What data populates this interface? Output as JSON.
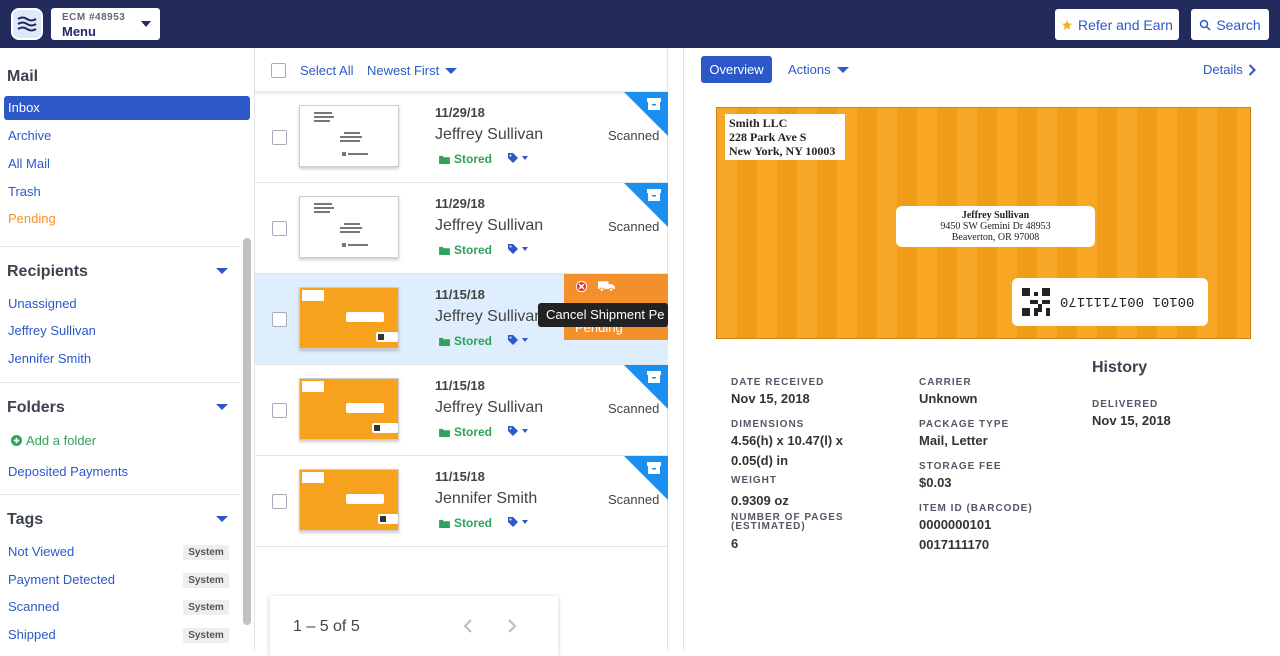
{
  "header": {
    "menu_small": "ECM #48953",
    "menu_big": "Menu",
    "refer_label": "Refer and Earn",
    "search_label": "Search"
  },
  "sidebar": {
    "mail_title": "Mail",
    "mail_items": [
      {
        "label": "Inbox"
      },
      {
        "label": "Archive"
      },
      {
        "label": "All Mail"
      },
      {
        "label": "Trash"
      },
      {
        "label": "Pending"
      }
    ],
    "recipients_title": "Recipients",
    "recipients": [
      {
        "label": "Unassigned"
      },
      {
        "label": "Jeffrey Sullivan"
      },
      {
        "label": "Jennifer Smith"
      }
    ],
    "folders_title": "Folders",
    "add_folder": "Add a folder",
    "folders": [
      {
        "label": "Deposited Payments"
      }
    ],
    "tags_title": "Tags",
    "tags": [
      {
        "label": "Not Viewed",
        "badge": "System"
      },
      {
        "label": "Payment Detected",
        "badge": "System"
      },
      {
        "label": "Scanned",
        "badge": "System"
      },
      {
        "label": "Shipped",
        "badge": "System"
      }
    ]
  },
  "list": {
    "select_all": "Select All",
    "sort": "Newest First",
    "rows": [
      {
        "date": "11/29/18",
        "name": "Jeffrey Sullivan",
        "stored": "Stored",
        "status": "Scanned"
      },
      {
        "date": "11/29/18",
        "name": "Jeffrey Sullivan",
        "stored": "Stored",
        "status": "Scanned"
      },
      {
        "date": "11/15/18",
        "name": "Jeffrey Sullivan",
        "stored": "Stored",
        "status": "Pending"
      },
      {
        "date": "11/15/18",
        "name": "Jeffrey Sullivan",
        "stored": "Stored",
        "status": "Scanned"
      },
      {
        "date": "11/15/18",
        "name": "Jennifer Smith",
        "stored": "Stored",
        "status": "Scanned"
      }
    ],
    "tooltip": "Cancel Shipment Pe",
    "pager": "1 – 5 of 5"
  },
  "detail": {
    "overview": "Overview",
    "actions": "Actions",
    "details": "Details",
    "envelope": {
      "return_line1": "Smith LLC",
      "return_line2": "228 Park Ave S",
      "return_line3": "New York, NY 10003",
      "to_line1": "Jeffrey Sullivan",
      "to_line2": "9450 SW Gemini Dr 48953",
      "to_line3": "Beaverton, OR 97008",
      "barcode": "00101 0017111170"
    },
    "fields": {
      "date_received_label": "DATE RECEIVED",
      "date_received": "Nov 15, 2018",
      "carrier_label": "CARRIER",
      "carrier": "Unknown",
      "dimensions_label": "DIMENSIONS",
      "dimensions_line1": "4.56(h) x 10.47(l) x",
      "dimensions_line2": "0.05(d) in",
      "package_type_label": "PACKAGE TYPE",
      "package_type": "Mail, Letter",
      "weight_label": "WEIGHT",
      "weight": "0.9309 oz",
      "storage_fee_label": "STORAGE FEE",
      "storage_fee": "$0.03",
      "pages_label_1": "NUMBER OF PAGES",
      "pages_label_2": "(ESTIMATED)",
      "pages": "6",
      "item_id_label": "ITEM ID (BARCODE)",
      "item_id_1": "0000000101",
      "item_id_2": "0017111170"
    },
    "history_title": "History",
    "history_label": "DELIVERED",
    "history_value": "Nov 15, 2018"
  },
  "colors": {
    "topbar": "#232a5c",
    "accent": "#2c58c8",
    "stored": "#2ea35a",
    "corner": "#1a8ff0",
    "envelope": "#f8a11a",
    "pending": "#f4902c"
  }
}
